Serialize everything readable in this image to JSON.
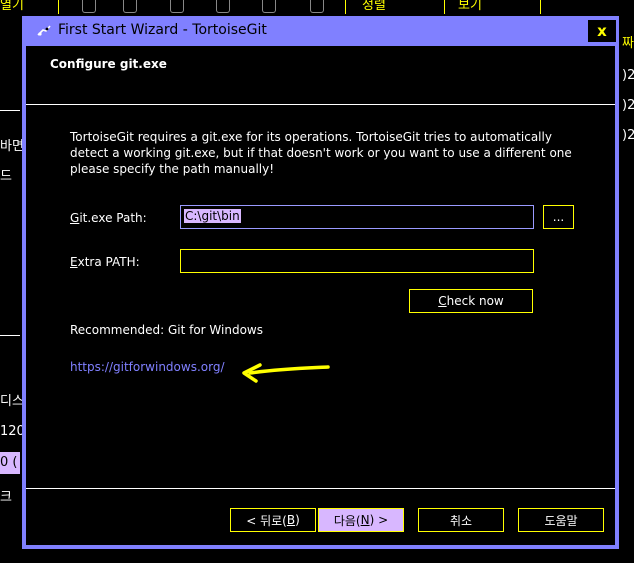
{
  "background": {
    "menu_left": "열기",
    "menu_sort": "정렬",
    "menu_view": "보기",
    "more": "···",
    "left_fragments": [
      "바면",
      "드",
      "디스",
      "120",
      "0 (",
      "크"
    ],
    "right_fragments": [
      "짜",
      ")2",
      ")2",
      ")2"
    ]
  },
  "dialog": {
    "title": "First Start Wizard - TortoiseGit",
    "close_label": "x",
    "header_title": "Configure git.exe",
    "description": "TortoiseGit requires a git.exe for its operations. TortoiseGit tries to automatically detect a working git.exe, but if that doesn't work or you want to use a different one please specify the path manually!",
    "git_path_label_access": "G",
    "git_path_label_rest": "it.exe Path:",
    "git_path_value": "C:\\git\\bin",
    "browse_label": "...",
    "extra_path_label_access": "E",
    "extra_path_label_rest": "xtra PATH:",
    "extra_path_value": "",
    "check_now_access": "C",
    "check_now_rest": "heck now",
    "recommended_text": "Recommended: Git for Windows",
    "link_text": "https://gitforwindows.org/",
    "back_label_pre": "< 뒤로(",
    "back_label_access": "B",
    "back_label_post": ")",
    "next_label_pre": "다음(",
    "next_label_access": "N",
    "next_label_post": ") >",
    "cancel_label": "취소",
    "help_label": "도움말"
  },
  "colors": {
    "accent": "#8080ff",
    "border": "#ffff00",
    "selection": "#d8b7ff",
    "link": "#8080ff",
    "annotation_arrow": "#ffff00"
  }
}
